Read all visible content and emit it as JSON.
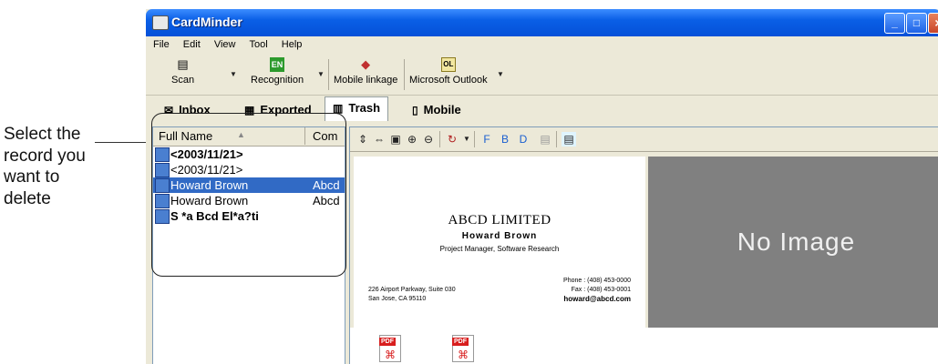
{
  "callout": {
    "lines": [
      "Select the",
      "record you",
      "want to",
      "delete"
    ]
  },
  "window": {
    "title": "CardMinder"
  },
  "menu": [
    "File",
    "Edit",
    "View",
    "Tool",
    "Help"
  ],
  "toolbar": [
    {
      "label": "Scan",
      "icon": "scanner-icon",
      "dropdown": true
    },
    {
      "label": "Recognition",
      "icon": "en-icon",
      "dropdown": true
    },
    {
      "label": "Mobile linkage",
      "icon": "mobile-linkage-icon",
      "dropdown": false
    },
    {
      "label": "Microsoft Outlook",
      "icon": "outlook-icon",
      "dropdown": true
    }
  ],
  "tabs": [
    {
      "label": "Inbox",
      "icon": "inbox-icon"
    },
    {
      "label": "Exported",
      "icon": "exported-icon"
    },
    {
      "label": "Trash",
      "icon": "trash-icon",
      "active": true
    },
    {
      "label": "Mobile",
      "icon": "mobile-icon"
    }
  ],
  "list": {
    "columns": [
      "Full Name",
      "Com"
    ],
    "rows": [
      {
        "name": "<2003/11/21>",
        "company": "",
        "bold": true
      },
      {
        "name": "<2003/11/21>",
        "company": "",
        "bold": false
      },
      {
        "name": "Howard Brown",
        "company": "Abcd",
        "selected": true
      },
      {
        "name": "Howard Brown",
        "company": "Abcd",
        "bold": false
      },
      {
        "name": "S *a Bcd El*a?ti",
        "company": "",
        "bold": true
      }
    ]
  },
  "card": {
    "company": "ABCD LIMITED",
    "name": "Howard Brown",
    "title": "Project Manager, Software Research",
    "address_line1": "226 Airport Parkway, Suite 030",
    "address_line2": "San Jose, CA 95110",
    "phone": "Phone : (408) 453-0000",
    "fax": "Fax : (408) 453-0001",
    "email": "howard@abcd.com"
  },
  "preview": {
    "no_image": "No Image"
  },
  "attachments": [
    {
      "label": "PDF"
    },
    {
      "label": "PDF"
    }
  ],
  "colors": {
    "title_bar": "#0a5fe6",
    "selection": "#316ac5",
    "no_image_bg": "#808080"
  }
}
